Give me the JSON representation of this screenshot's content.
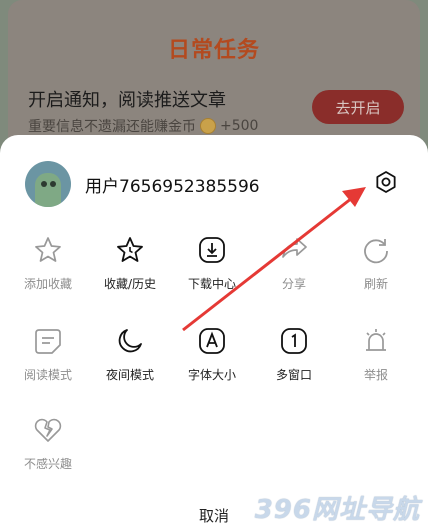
{
  "task_card": {
    "title": "日常任务",
    "task_name": "开启通知，阅读推送文章",
    "task_desc": "重要信息不遗漏还能赚金币",
    "reward": "+500",
    "go_button": "去开启"
  },
  "sheet": {
    "username": "用户7656952385596",
    "cancel_label": "取消",
    "actions": [
      {
        "label": "添加收藏",
        "icon": "star-icon",
        "enabled": false
      },
      {
        "label": "收藏/历史",
        "icon": "star-clock-icon",
        "enabled": true
      },
      {
        "label": "下载中心",
        "icon": "download-icon",
        "enabled": true
      },
      {
        "label": "分享",
        "icon": "share-icon",
        "enabled": false
      },
      {
        "label": "刷新",
        "icon": "refresh-icon",
        "enabled": false
      },
      {
        "label": "阅读模式",
        "icon": "reading-mode-icon",
        "enabled": false
      },
      {
        "label": "夜间模式",
        "icon": "moon-icon",
        "enabled": true
      },
      {
        "label": "字体大小",
        "icon": "font-size-icon",
        "enabled": true
      },
      {
        "label": "多窗口",
        "icon": "multi-window-icon",
        "enabled": true
      },
      {
        "label": "举报",
        "icon": "alarm-icon",
        "enabled": false
      },
      {
        "label": "不感兴趣",
        "icon": "broken-heart-icon",
        "enabled": false
      }
    ]
  },
  "watermark": "396网址导航",
  "colors": {
    "accent_red": "#e53935",
    "disabled_gray": "#8d8d8d"
  }
}
